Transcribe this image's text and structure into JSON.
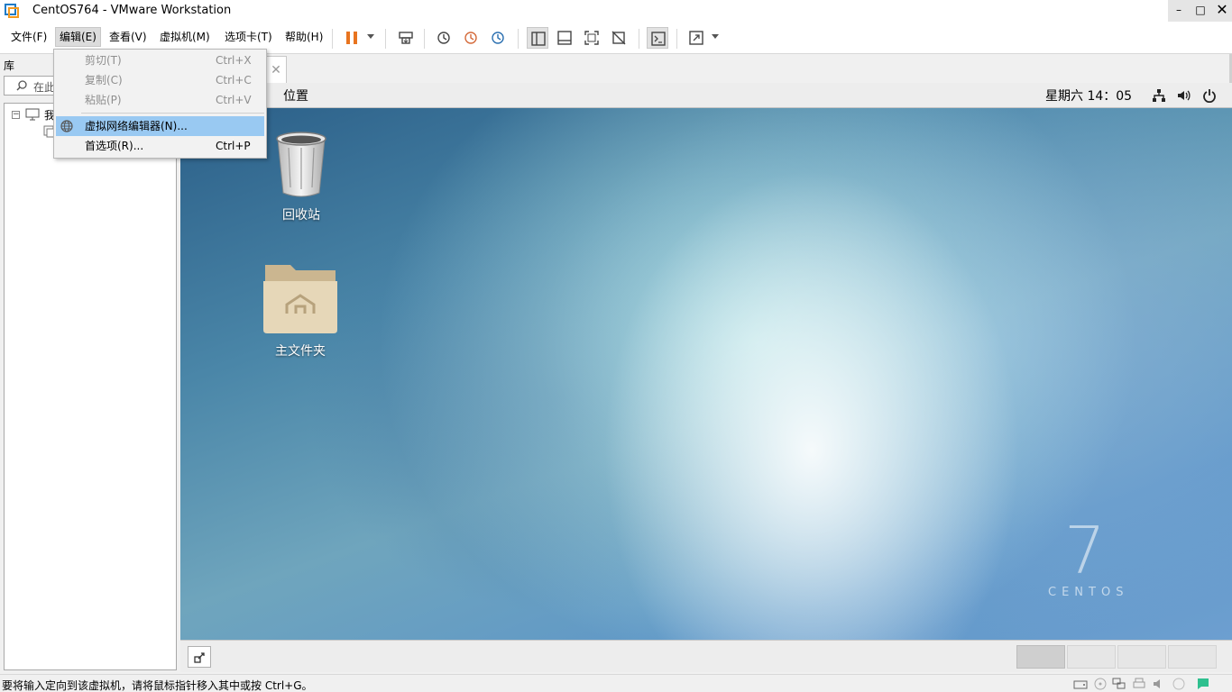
{
  "window": {
    "title": "CentOS764 - VMware Workstation",
    "minimize_glyph": "–",
    "maximize_glyph": "□",
    "close_glyph": "✕"
  },
  "menubar": {
    "items": [
      {
        "label": "文件(F)"
      },
      {
        "label": "编辑(E)"
      },
      {
        "label": "查看(V)"
      },
      {
        "label": "虚拟机(M)"
      },
      {
        "label": "选项卡(T)"
      },
      {
        "label": "帮助(H)"
      }
    ],
    "toolbar_icons": [
      "pause-icon",
      "send-ctrl-alt-del-icon",
      "snapshot-icon",
      "revert-snapshot-icon",
      "snapshot-manager-icon",
      "library-view-icon",
      "thumbnail-bar-icon",
      "fit-guest-icon",
      "unity-icon",
      "console-icon",
      "fullscreen-icon"
    ],
    "accent_color": "#e8741f"
  },
  "edit_menu": {
    "items": [
      {
        "label": "剪切(T)",
        "shortcut": "Ctrl+X",
        "enabled": false
      },
      {
        "label": "复制(C)",
        "shortcut": "Ctrl+C",
        "enabled": false
      },
      {
        "label": "粘贴(P)",
        "shortcut": "Ctrl+V",
        "enabled": false
      },
      {
        "label": "虚拟网络编辑器(N)...",
        "shortcut": "",
        "enabled": true,
        "highlighted": true,
        "icon": "network-globe-icon"
      },
      {
        "label": "首选项(R)...",
        "shortcut": "Ctrl+P",
        "enabled": true
      }
    ]
  },
  "library": {
    "title": "库",
    "search_placeholder": "在此",
    "tree_root_label": "我"
  },
  "vm_tab": {
    "close_glyph": "✕"
  },
  "guest": {
    "topbar": {
      "places_label": "位置",
      "clock": "星期六 14：05",
      "tray_icons": [
        "network-icon",
        "volume-icon",
        "power-icon"
      ]
    },
    "desktop_icons": [
      {
        "label": "回收站",
        "icon": "trash-icon"
      },
      {
        "label": "主文件夹",
        "icon": "home-folder-icon"
      }
    ],
    "watermark_numeral": "7",
    "watermark_text": "CENTOS",
    "workspaces": 4,
    "active_workspace": 1
  },
  "statusbar": {
    "text": "要将输入定向到该虚拟机，请将鼠标指针移入其中或按 Ctrl+G。",
    "icons": [
      "hard-disk-icon",
      "cd-icon",
      "network-adapter-icon",
      "printer-icon",
      "sound-icon",
      "display-icon",
      "message-icon"
    ]
  }
}
